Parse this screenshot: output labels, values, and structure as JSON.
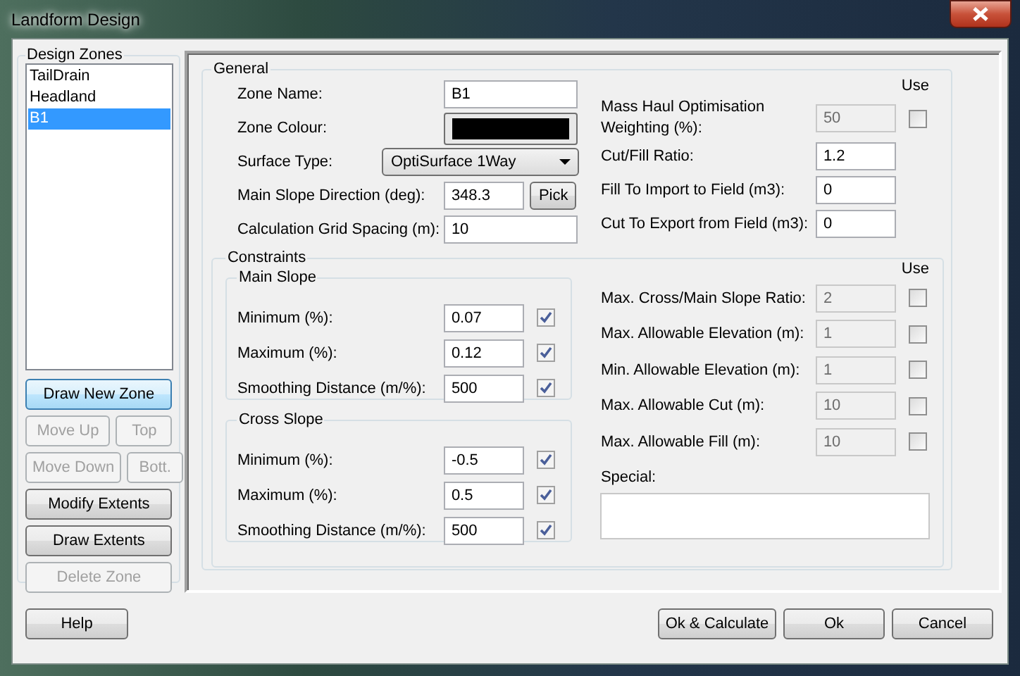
{
  "window": {
    "title": "Landform Design"
  },
  "design_zones": {
    "label": "Design Zones",
    "items": [
      {
        "label": "TailDrain",
        "selected": false
      },
      {
        "label": "Headland",
        "selected": false
      },
      {
        "label": "B1",
        "selected": true
      }
    ],
    "button_rows": [
      [
        {
          "label": "Draw New Zone",
          "disabled": false,
          "focused": true
        }
      ],
      [
        {
          "label": "Move Up",
          "disabled": true,
          "focused": false
        },
        {
          "label": "Top",
          "disabled": true,
          "focused": false
        }
      ],
      [
        {
          "label": "Move Down",
          "disabled": true,
          "focused": false
        },
        {
          "label": "Bott.",
          "disabled": true,
          "focused": false
        }
      ],
      [
        {
          "label": "Modify Extents",
          "disabled": false,
          "focused": false
        }
      ],
      [
        {
          "label": "Draw Extents",
          "disabled": false,
          "focused": false
        }
      ],
      [
        {
          "label": "Delete Zone",
          "disabled": true,
          "focused": false
        }
      ]
    ]
  },
  "general": {
    "label": "General",
    "fields": [
      {
        "kind": "text",
        "label": "Zone Name:",
        "value": "B1"
      },
      {
        "kind": "color",
        "label": "Zone Colour:",
        "color": "#000000"
      },
      {
        "kind": "select",
        "label": "Surface Type:",
        "value": "OptiSurface 1Way"
      },
      {
        "kind": "pick",
        "label": "Main Slope Direction (deg):",
        "value": "348.3",
        "button": "Pick"
      },
      {
        "kind": "text",
        "label": "Calculation Grid Spacing (m):",
        "value": "10"
      }
    ],
    "use_label": "Use",
    "options": [
      {
        "kind": "toggle",
        "label": "Mass Haul Optimisation Weighting (%):",
        "value": "50",
        "disabled": true,
        "checked": false
      },
      {
        "kind": "plain",
        "label": "Cut/Fill Ratio:",
        "value": "1.2",
        "disabled": false
      },
      {
        "kind": "plain",
        "label": "Fill To Import to Field (m3):",
        "value": "0",
        "disabled": false
      },
      {
        "kind": "plain",
        "label": "Cut To Export from Field (m3):",
        "value": "0",
        "disabled": false
      }
    ]
  },
  "constraints": {
    "label": "Constraints",
    "groups": [
      {
        "label": "Main Slope",
        "rows": [
          {
            "label": "Minimum (%):",
            "value": "0.07",
            "checked": true
          },
          {
            "label": "Maximum (%):",
            "value": "0.12",
            "checked": true
          },
          {
            "label": "Smoothing Distance (m/%):",
            "value": "500",
            "checked": true
          }
        ]
      },
      {
        "label": "Cross Slope",
        "rows": [
          {
            "label": "Minimum (%):",
            "value": "-0.5",
            "checked": true
          },
          {
            "label": "Maximum (%):",
            "value": "0.5",
            "checked": true
          },
          {
            "label": "Smoothing Distance (m/%):",
            "value": "500",
            "checked": true
          }
        ]
      }
    ],
    "use_label": "Use",
    "limits": [
      {
        "label": "Max. Cross/Main Slope Ratio:",
        "value": "2",
        "disabled": true,
        "checked": false
      },
      {
        "label": "Max. Allowable Elevation (m):",
        "value": "1",
        "disabled": true,
        "checked": false
      },
      {
        "label": "Min. Allowable Elevation (m):",
        "value": "1",
        "disabled": true,
        "checked": false
      },
      {
        "label": "Max. Allowable Cut (m):",
        "value": "10",
        "disabled": true,
        "checked": false
      },
      {
        "label": "Max. Allowable Fill (m):",
        "value": "10",
        "disabled": true,
        "checked": false
      }
    ],
    "special": {
      "label": "Special:"
    }
  },
  "footer": {
    "help": "Help",
    "buttons": [
      "Ok & Calculate",
      "Ok",
      "Cancel"
    ]
  }
}
